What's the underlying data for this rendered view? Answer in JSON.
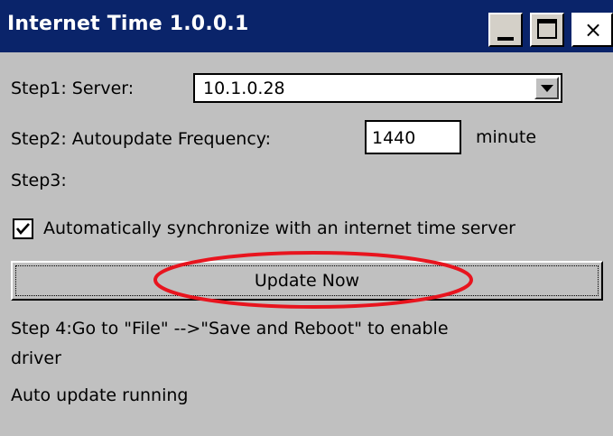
{
  "window": {
    "title": "Internet Time 1.0.0.1",
    "title_bar_color": "#0a246a",
    "background_color": "#c0c0c0"
  },
  "titlebar_buttons": {
    "minimize_icon": "minimize-icon",
    "maximize_icon": "maximize-icon",
    "close_icon": "close-icon",
    "close_glyph": "×"
  },
  "step1": {
    "label": "Step1: Server:",
    "server_value": "10.1.0.28"
  },
  "step2": {
    "label": "Step2: Autoupdate Frequency:",
    "frequency_value": "1440",
    "unit": "minute"
  },
  "step3": {
    "label": "Step3:",
    "checkbox_checked": true,
    "checkbox_label": "Automatically synchronize with an internet time server"
  },
  "update_button": {
    "label": "Update Now",
    "highlight_color": "#e8141e"
  },
  "step4": {
    "line1": "Step 4:Go to \"File\" -->\"Save and Reboot\" to enable",
    "line2": "driver"
  },
  "status": {
    "text": "Auto update running"
  }
}
